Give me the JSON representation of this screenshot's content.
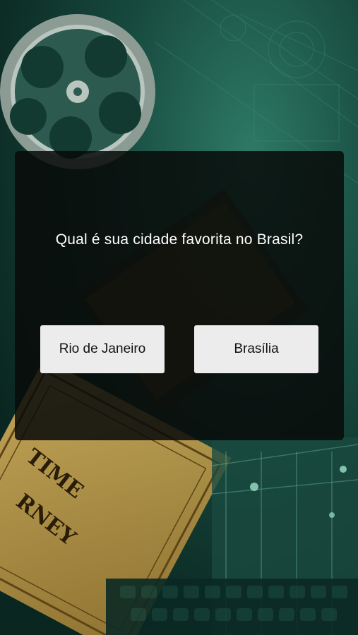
{
  "background": {
    "scene": "cinema-theater-artwork",
    "ticket_text_line1": "TIME",
    "ticket_text_line2": "RNEY",
    "colors": {
      "teal_dark": "#0f3b32",
      "teal_mid": "#1f5d4f",
      "ticket_gold": "#c8a04a"
    }
  },
  "dialog": {
    "question": "Qual é sua cidade favorita no Brasil?",
    "options": [
      {
        "label": "Rio de Janeiro"
      },
      {
        "label": "Brasília"
      }
    ]
  }
}
